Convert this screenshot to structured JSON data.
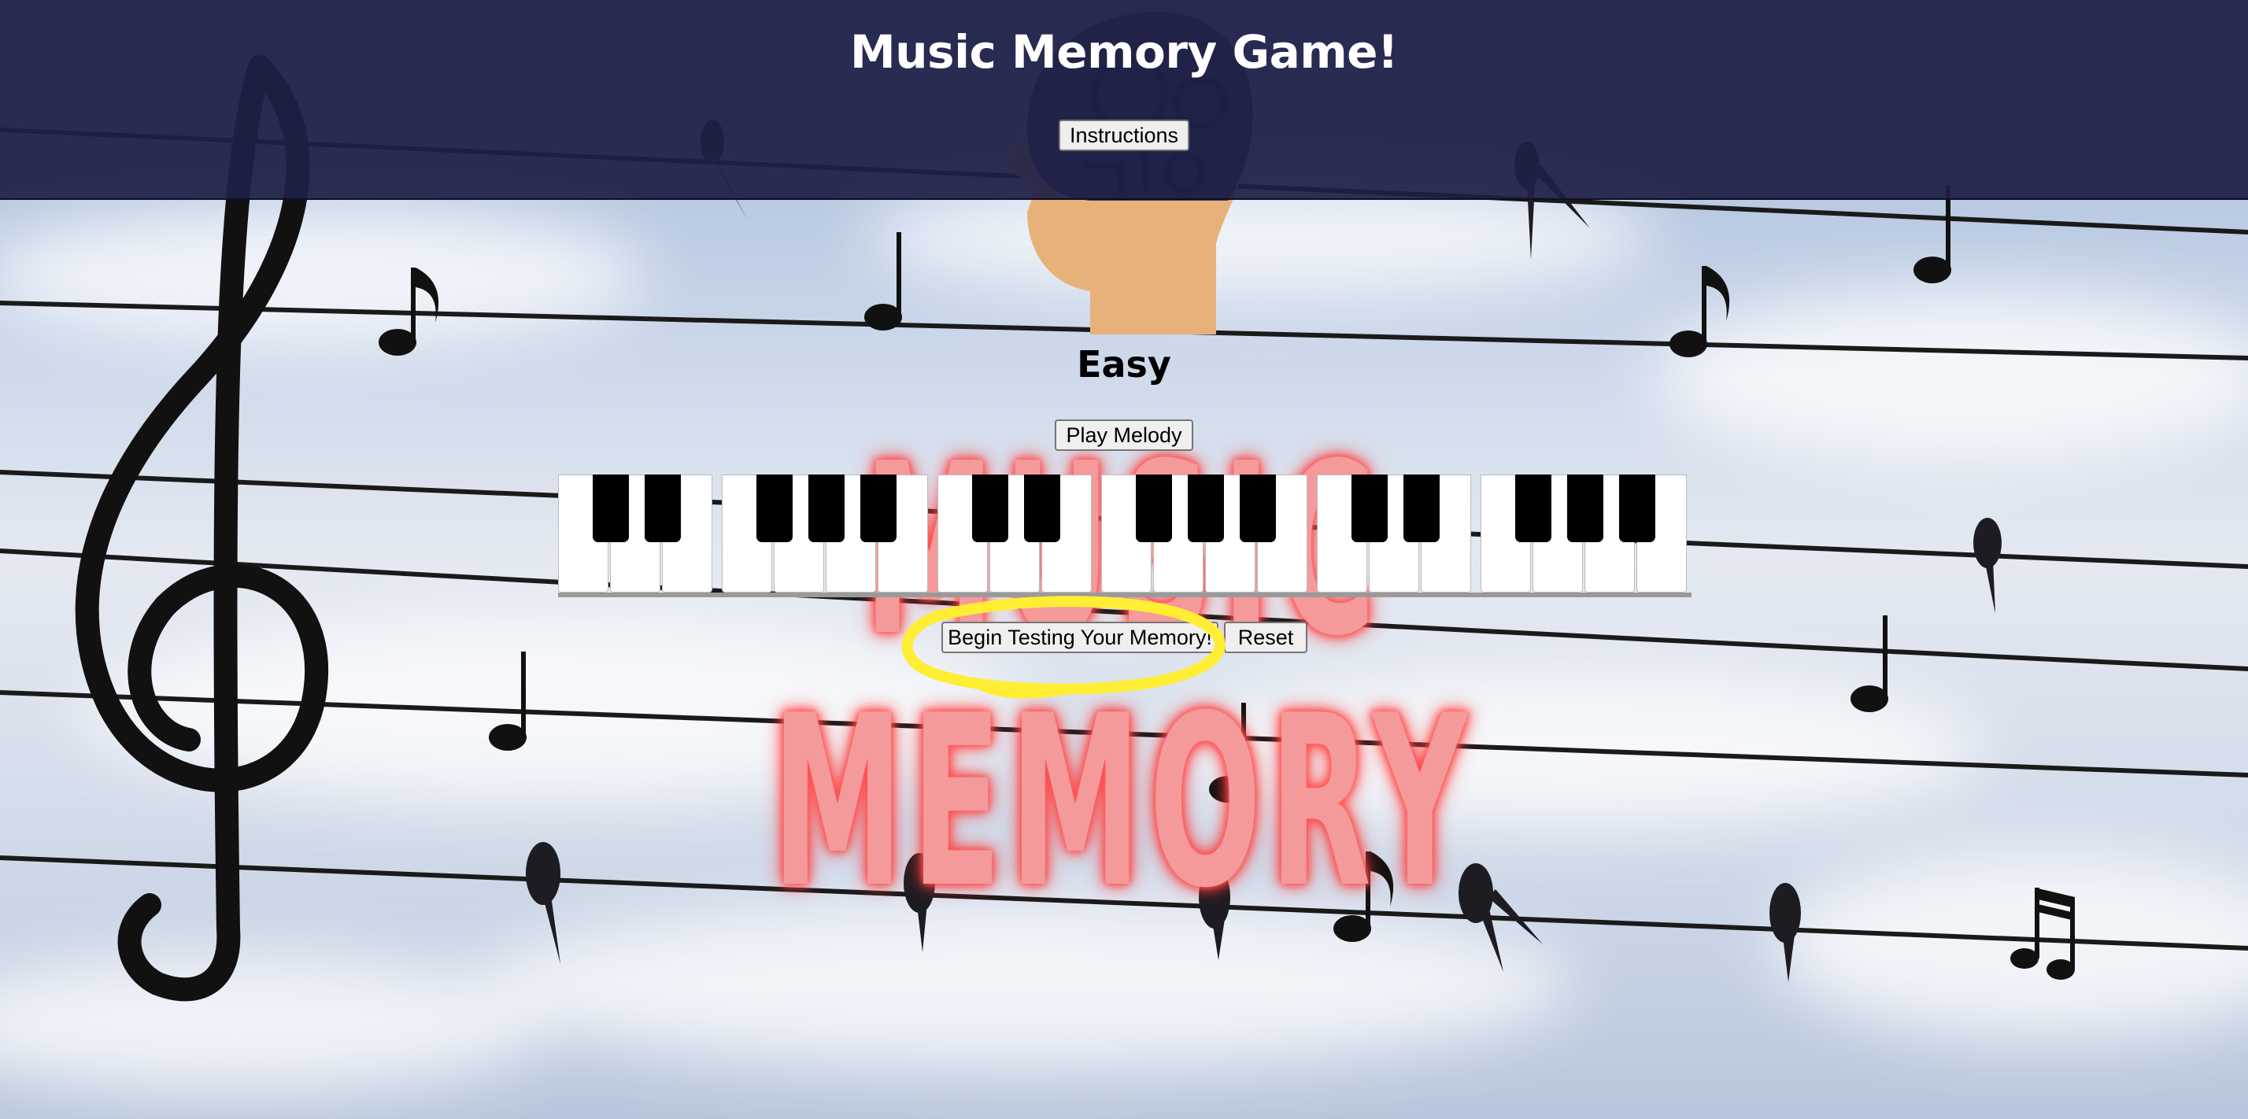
{
  "header": {
    "title": "Music Memory Game!",
    "instructions_label": "Instructions",
    "background_color": "#1e2046"
  },
  "game": {
    "difficulty": "Easy",
    "play_melody_label": "Play Melody",
    "begin_label": "Begin Testing Your Memory!",
    "reset_label": "Reset"
  },
  "background": {
    "word": "MUSIC MEMORY",
    "word_color": "#f49a9a",
    "glow_color": "#ff3d3d",
    "sky_color": "#c7d4e8"
  },
  "piano": {
    "white_keys": 21,
    "black_key_pattern": [
      "C#",
      "D#",
      "F#",
      "G#",
      "A#"
    ]
  },
  "annotation": {
    "highlight_color": "#ffee33",
    "highlighted": "begin-testing-button"
  },
  "icons": [
    "treble-clef-icon",
    "head-gears-icon",
    "music-note-icon",
    "bird-icon"
  ]
}
